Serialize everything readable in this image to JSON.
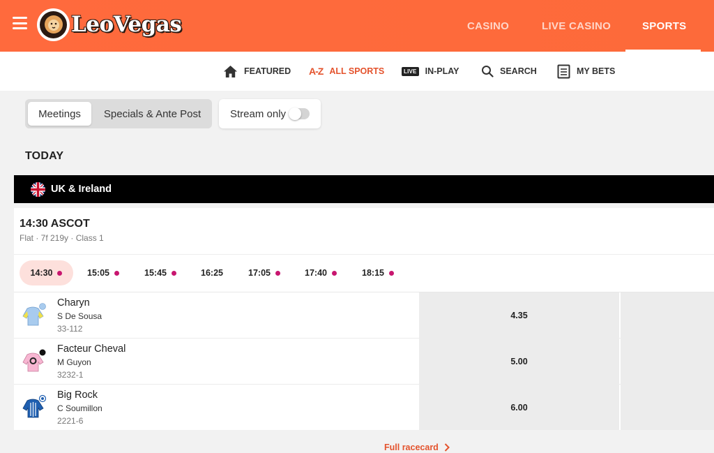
{
  "brand": {
    "logo_text": "LeoVegas"
  },
  "top_nav": [
    {
      "label": "CASINO",
      "active": false
    },
    {
      "label": "LIVE CASINO",
      "active": false
    },
    {
      "label": "SPORTS",
      "active": true
    }
  ],
  "sub_nav": [
    {
      "label": "FEATURED",
      "icon": "home-icon"
    },
    {
      "label": "ALL SPORTS",
      "icon": "a-z-icon",
      "icon_text": "A-Z"
    },
    {
      "label": "IN-PLAY",
      "icon": "live-icon",
      "icon_text": "LIVE"
    },
    {
      "label": "SEARCH",
      "icon": "search-icon"
    },
    {
      "label": "MY BETS",
      "icon": "betslip-icon"
    }
  ],
  "filters": {
    "segments": [
      "Meetings",
      "Specials & Ante Post"
    ],
    "active_segment": "Meetings",
    "stream_label": "Stream only",
    "stream_on": false
  },
  "day_heading": "TODAY",
  "region": {
    "name": "UK & Ireland"
  },
  "race": {
    "title": "14:30 ASCOT",
    "subtitle": "Flat · 7f 219y · Class 1",
    "times": [
      {
        "time": "14:30",
        "stream": true,
        "active": true
      },
      {
        "time": "15:05",
        "stream": true,
        "active": false
      },
      {
        "time": "15:45",
        "stream": true,
        "active": false
      },
      {
        "time": "16:25",
        "stream": false,
        "active": false
      },
      {
        "time": "17:05",
        "stream": true,
        "active": false
      },
      {
        "time": "17:40",
        "stream": true,
        "active": false
      },
      {
        "time": "18:15",
        "stream": true,
        "active": false
      }
    ],
    "runners": [
      {
        "name": "Charyn",
        "jockey": "S De Sousa",
        "form": "33-112",
        "odds": "4.35"
      },
      {
        "name": "Facteur Cheval",
        "jockey": "M Guyon",
        "form": "3232-1",
        "odds": "5.00"
      },
      {
        "name": "Big Rock",
        "jockey": "C Soumillon",
        "form": "2221-6",
        "odds": "6.00"
      }
    ],
    "full_racecard_label": "Full racecard"
  },
  "colors": {
    "brand_orange": "#ff6a3d",
    "accent": "#e4532d",
    "stream_dot": "#c8166f"
  }
}
